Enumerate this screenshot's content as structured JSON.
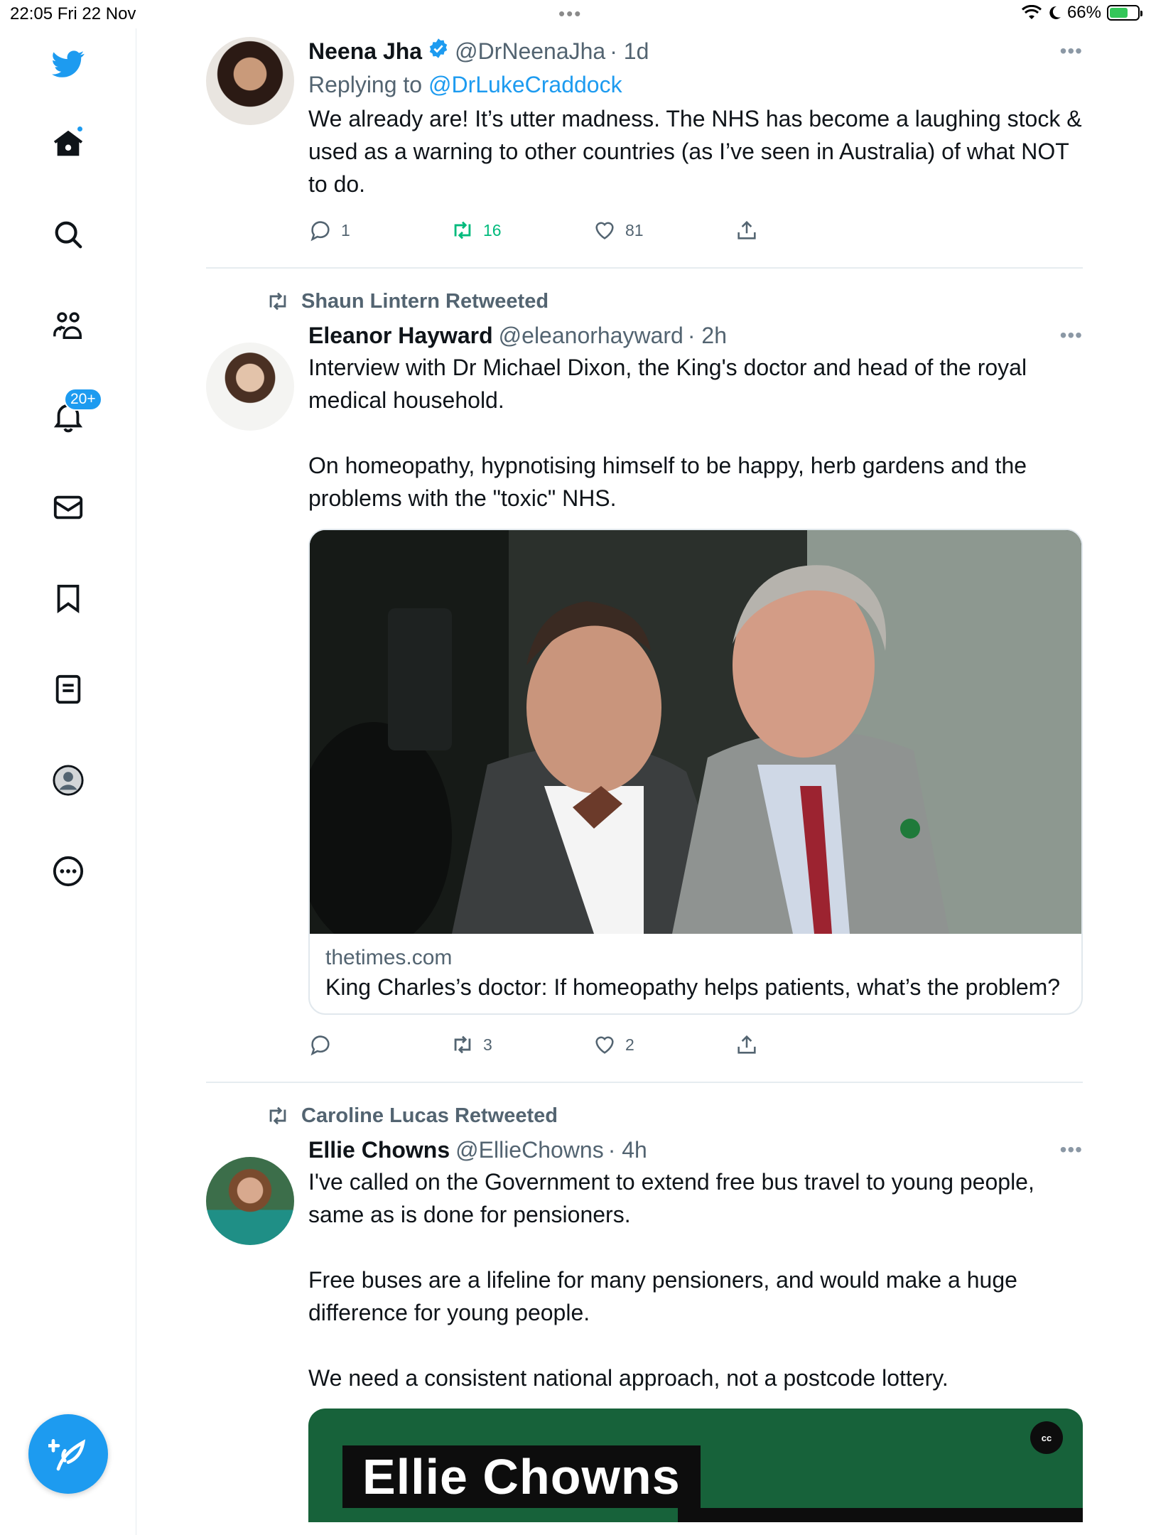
{
  "status_bar": {
    "time_date": "22:05   Fri 22 Nov",
    "battery": "66%",
    "battery_level": 0.66
  },
  "sidebar": {
    "nav": [
      "twitter-logo",
      "home",
      "search",
      "communities",
      "notifications",
      "messages",
      "bookmarks",
      "lists",
      "profile",
      "more"
    ],
    "notifications_badge": "20+"
  },
  "tweets": [
    {
      "name": "Neena Jha",
      "handle": "@DrNeenaJha",
      "time": "· 1d",
      "verified": true,
      "replying_prefix": "Replying to ",
      "replying_to": "@DrLukeCraddock",
      "text": "We already are! It’s utter madness. The NHS has become a laughing stock & used as a warning to other countries (as I’ve seen in Australia) of what NOT to do.",
      "replies": "1",
      "retweets": "16",
      "likes": "81"
    },
    {
      "retweeted_by": "Shaun Lintern Retweeted",
      "name": "Eleanor Hayward",
      "handle": "@eleanorhayward",
      "time": "· 2h",
      "text": "Interview with Dr Michael Dixon, the King's doctor and head of the royal medical household.\n\nOn homeopathy, hypnotising himself to be happy, herb gardens and the problems with the \"toxic\" NHS.",
      "card": {
        "domain": "thetimes.com",
        "title": "King Charles’s doctor: If homeopathy helps patients, what’s the problem?"
      },
      "replies": "",
      "retweets": "3",
      "likes": "2"
    },
    {
      "retweeted_by": "Caroline Lucas Retweeted",
      "name": "Ellie Chowns",
      "handle": "@EllieChowns",
      "time": "· 4h",
      "text": "I've called on the Government to extend free bus travel to young people, same as is done for pensioners.\n\nFree buses are a lifeline for many pensioners, and would make a huge difference for young people.\n\nWe need a consistent national approach, not a postcode lottery.",
      "video_title": "Ellie Chowns",
      "cc_label": "cc"
    }
  ],
  "colors": {
    "accent": "#1d9bf0",
    "retweet": "#00ba7c",
    "secondary_text": "#536471"
  }
}
